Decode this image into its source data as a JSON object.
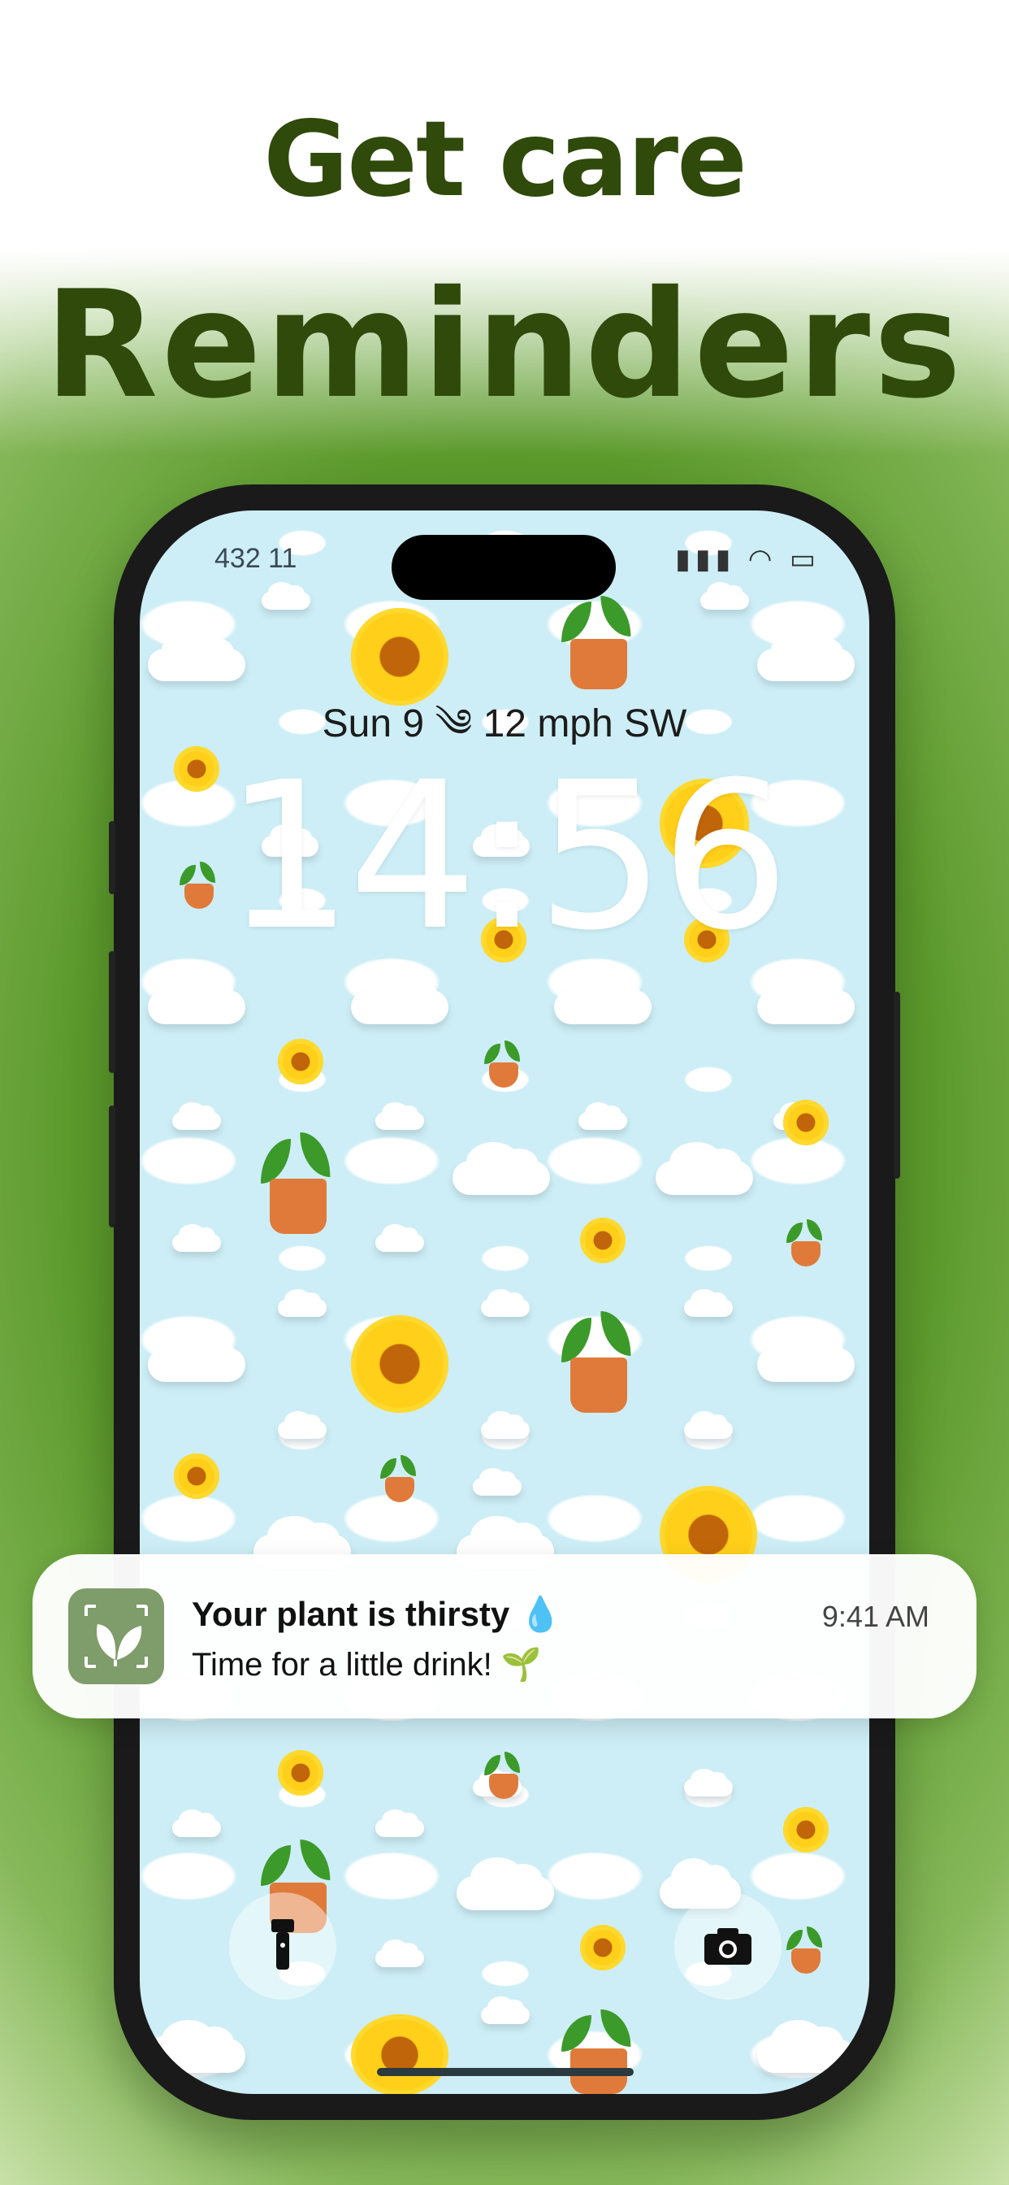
{
  "headline": {
    "line1": "Get care",
    "line2": "Reminders"
  },
  "status_bar": {
    "carrier": "432 11"
  },
  "lock_screen": {
    "weather": "Sun 9 ༄ 12 mph SW",
    "time": "14:56"
  },
  "notification": {
    "title": "Your plant is thirsty 💧",
    "body": "Time for a little drink! 🌱",
    "time": "9:41 AM"
  },
  "quick_actions": {
    "left_icon": "flashlight-icon",
    "right_icon": "camera-icon"
  },
  "colors": {
    "headline": "#2f4a0b",
    "app_icon_bg": "#7f9c6b",
    "wallpaper": "#cdeef6"
  }
}
